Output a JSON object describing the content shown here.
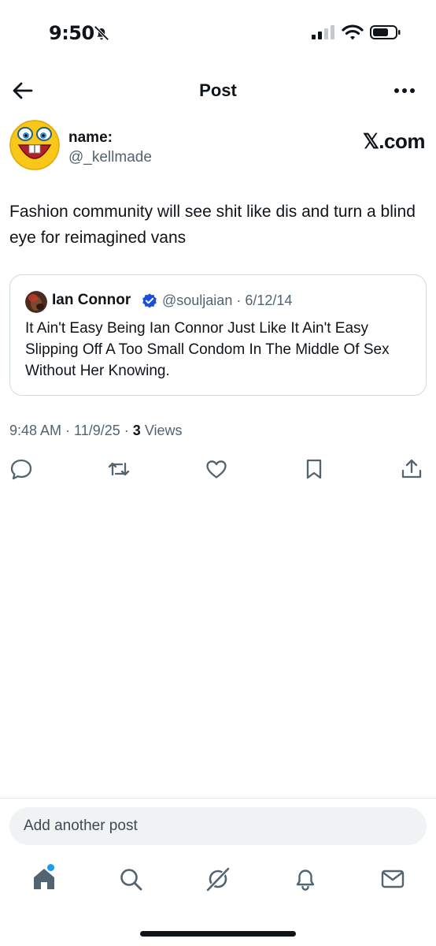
{
  "status": {
    "time": "9:50"
  },
  "topbar": {
    "title": "Post"
  },
  "author": {
    "display_name": "name:",
    "handle": "@_kellmade",
    "brand": "𝕏.com"
  },
  "post": {
    "text": "Fashion community will see shit like dis and turn a blind eye for reimagined vans",
    "time": "9:48 AM",
    "date": "11/9/25",
    "views_count": "3",
    "views_label": "Views"
  },
  "quote": {
    "name": "Ian Connor",
    "handle_date": "@souljaian · 6/12/14",
    "text": "It Ain't Easy Being Ian Connor Just Like It Ain't Easy Slipping Off A Too Small Condom In The Middle Of Sex Without Her Knowing."
  },
  "reply": {
    "placeholder": "Add another post"
  },
  "colors": {
    "accent": "#1d9bf0",
    "secondary_text": "#536471",
    "icon_gray": "#536471"
  },
  "icons": {
    "actions": [
      "reply-icon",
      "repost-icon",
      "like-icon",
      "bookmark-icon",
      "share-icon"
    ],
    "tabs": [
      "home-icon",
      "search-icon",
      "grok-icon",
      "notifications-icon",
      "messages-icon"
    ]
  }
}
